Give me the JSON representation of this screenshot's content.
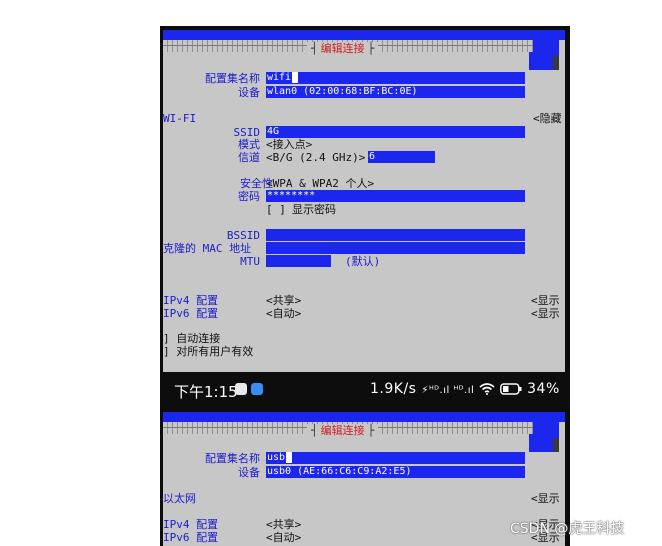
{
  "screen1": {
    "title": "编辑连接",
    "profile_label": "配置集名称",
    "profile_value": "wifi",
    "device_label": "设备",
    "device_value": "wlan0 (02:00:68:BF:BC:0E)",
    "section": "WI-FI",
    "hide_label": "<隐藏",
    "ssid_label": "SSID",
    "ssid_value": "4G",
    "mode_label": "模式",
    "mode_value": "<接入点>",
    "channel_label": "信道",
    "channel_value": "<B/G (2.4 GHz)>",
    "channel_number": "6",
    "security_label": "安全性",
    "security_value": "<WPA & WPA2 个人>",
    "password_label": "密码",
    "password_value": "********",
    "show_password_checkbox": "[ ]",
    "show_password_label": "显示密码",
    "bssid_label": "BSSID",
    "clone_mac_label": "克隆的 MAC 地址",
    "mtu_label": "MTU",
    "mtu_default": "(默认)",
    "ipv4_label": "IPv4 配置",
    "ipv4_value": "<共享>",
    "ipv4_show": "<显示",
    "ipv6_label": "IPv6 配置",
    "ipv6_value": "<自动>",
    "ipv6_show": "<显示",
    "autoconnect": "] 自动连接",
    "all_users": "] 对所有用户有效"
  },
  "status_bar": {
    "time": "下午1:15",
    "net_speed": "1.9K/s",
    "signal": "⚡ᴴᴰ.ıl ᴴᴰ.ıl",
    "wifi_icon": "wifi-icon",
    "battery": "34%",
    "app_colors": [
      "#e8e8e8",
      "#3a8cf0"
    ]
  },
  "screen2": {
    "title": "编辑连接",
    "profile_label": "配置集名称",
    "profile_value": "usb",
    "device_label": "设备",
    "device_value": "usb0 (AE:66:C6:C9:A2:E5)",
    "section": "以太网",
    "section_show": "<显示",
    "ipv4_label": "IPv4 配置",
    "ipv4_value": "<共享>",
    "ipv4_show": "<显示",
    "ipv6_label": "IPv6 配置",
    "ipv6_value": "<自动>",
    "ipv6_show": "<显示"
  },
  "watermark": "CSDN @虎王科技"
}
